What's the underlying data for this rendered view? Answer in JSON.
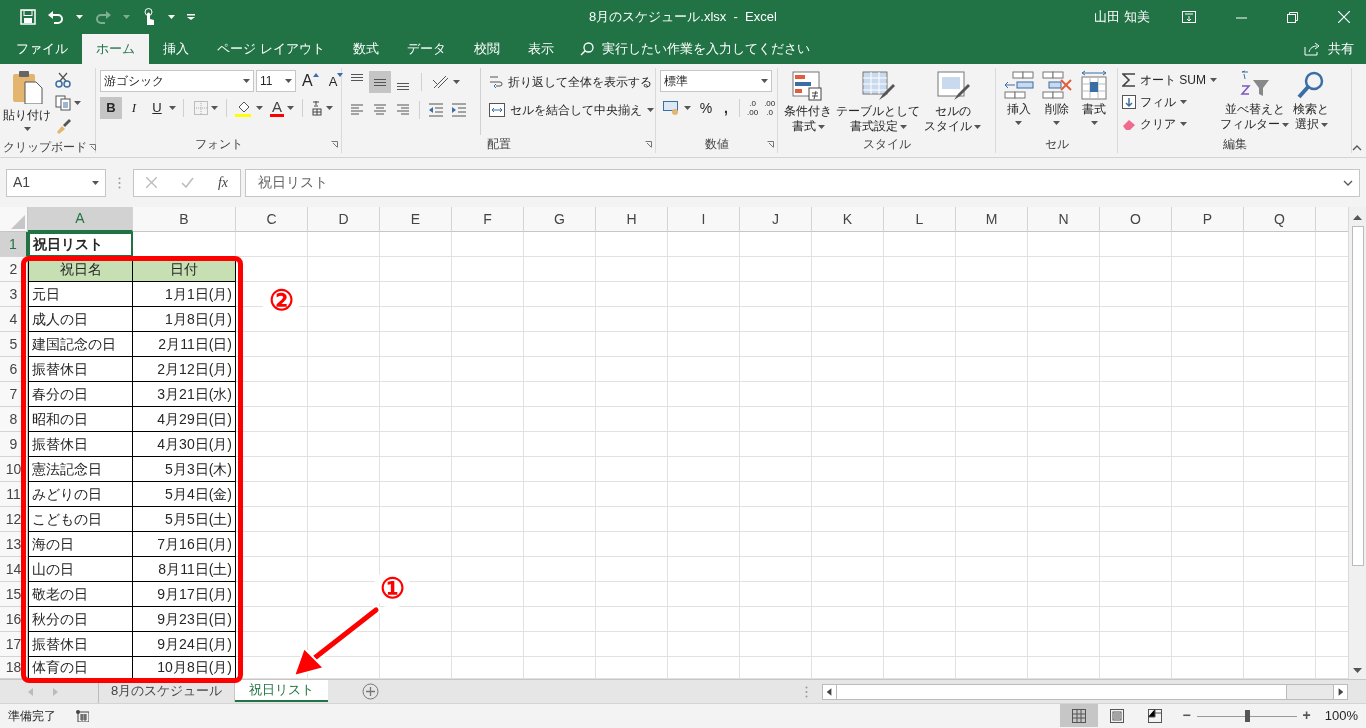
{
  "window": {
    "title": "8月のスケジュール.xlsx  -  Excel",
    "user": "山田 知美"
  },
  "ribbon_tabs": [
    {
      "label": "ファイル",
      "selected": false
    },
    {
      "label": "ホーム",
      "selected": true
    },
    {
      "label": "挿入",
      "selected": false
    },
    {
      "label": "ページ レイアウト",
      "selected": false
    },
    {
      "label": "数式",
      "selected": false
    },
    {
      "label": "データ",
      "selected": false
    },
    {
      "label": "校閲",
      "selected": false
    },
    {
      "label": "表示",
      "selected": false
    }
  ],
  "tell_me": {
    "placeholder": "実行したい作業を入力してください"
  },
  "share": "共有",
  "ribbon": [
    {
      "kind": "clipboard",
      "label": "クリップボード",
      "paste": "貼り付け"
    },
    {
      "kind": "font",
      "label": "フォント",
      "font_name": "游ゴシック",
      "font_size": "11",
      "grow": "A",
      "shrink": "A",
      "styles": [
        {
          "text": "B",
          "on": true
        },
        {
          "text": "I",
          "on": false
        },
        {
          "text": "U",
          "on": false
        }
      ],
      "font_color": "A"
    },
    {
      "kind": "alignment",
      "label": "配置",
      "vertical_align": [
        {
          "selected": false
        },
        {
          "selected": true
        },
        {
          "selected": false
        }
      ],
      "wrap_text": "折り返して全体を表示する",
      "merge_center": "セルを結合して中央揃え"
    },
    {
      "kind": "number",
      "label": "数値",
      "format": "標準",
      "percent": "%",
      "comma": ",",
      "increase_decimal": [
        ".0",
        ".00"
      ],
      "decrease_decimal": [
        ".00",
        ".0"
      ]
    },
    {
      "kind": "styles",
      "label": "スタイル",
      "buttons": [
        [
          "条件付き",
          "書式"
        ],
        [
          "テーブルとして",
          "書式設定"
        ],
        [
          "セルの",
          "スタイル"
        ]
      ]
    },
    {
      "kind": "cells",
      "label": "セル",
      "buttons": [
        "挿入",
        "削除",
        "書式"
      ]
    },
    {
      "kind": "editing",
      "label": "編集",
      "autosum": "オート SUM",
      "fill": "フィル",
      "clear": "クリア",
      "buttons": [
        [
          "並べ替えと",
          "フィルター"
        ],
        [
          "検索と",
          "選択"
        ]
      ]
    }
  ],
  "formula_bar": {
    "name_box": "A1",
    "fx": "fx",
    "value": "祝日リスト"
  },
  "sheet": {
    "columns": [
      {
        "label": "A",
        "selected": true
      },
      {
        "label": "B",
        "selected": false
      },
      {
        "label": "C",
        "selected": false
      },
      {
        "label": "D",
        "selected": false
      },
      {
        "label": "E",
        "selected": false
      },
      {
        "label": "F",
        "selected": false
      },
      {
        "label": "G",
        "selected": false
      },
      {
        "label": "H",
        "selected": false
      },
      {
        "label": "I",
        "selected": false
      },
      {
        "label": "J",
        "selected": false
      },
      {
        "label": "K",
        "selected": false
      },
      {
        "label": "L",
        "selected": false
      },
      {
        "label": "M",
        "selected": false
      },
      {
        "label": "N",
        "selected": false
      },
      {
        "label": "O",
        "selected": false
      },
      {
        "label": "P",
        "selected": false
      },
      {
        "label": "Q",
        "selected": false
      }
    ],
    "rows": [
      {
        "number": "1",
        "selected": true,
        "kind": "title",
        "cells": [
          "祝日リスト"
        ]
      },
      {
        "number": "2",
        "selected": false,
        "kind": "header",
        "cells": [
          "祝日名",
          "日付"
        ]
      },
      {
        "number": "3",
        "selected": false,
        "kind": "data",
        "cells": [
          "元日",
          "1月1日(月)"
        ]
      },
      {
        "number": "4",
        "selected": false,
        "kind": "data",
        "cells": [
          "成人の日",
          "1月8日(月)"
        ]
      },
      {
        "number": "5",
        "selected": false,
        "kind": "data",
        "cells": [
          "建国記念の日",
          "2月11日(日)"
        ]
      },
      {
        "number": "6",
        "selected": false,
        "kind": "data",
        "cells": [
          "振替休日",
          "2月12日(月)"
        ]
      },
      {
        "number": "7",
        "selected": false,
        "kind": "data",
        "cells": [
          "春分の日",
          "3月21日(水)"
        ]
      },
      {
        "number": "8",
        "selected": false,
        "kind": "data",
        "cells": [
          "昭和の日",
          "4月29日(日)"
        ]
      },
      {
        "number": "9",
        "selected": false,
        "kind": "data",
        "cells": [
          "振替休日",
          "4月30日(月)"
        ]
      },
      {
        "number": "10",
        "selected": false,
        "kind": "data",
        "cells": [
          "憲法記念日",
          "5月3日(木)"
        ]
      },
      {
        "number": "11",
        "selected": false,
        "kind": "data",
        "cells": [
          "みどりの日",
          "5月4日(金)"
        ]
      },
      {
        "number": "12",
        "selected": false,
        "kind": "data",
        "cells": [
          "こどもの日",
          "5月5日(土)"
        ]
      },
      {
        "number": "13",
        "selected": false,
        "kind": "data",
        "cells": [
          "海の日",
          "7月16日(月)"
        ]
      },
      {
        "number": "14",
        "selected": false,
        "kind": "data",
        "cells": [
          "山の日",
          "8月11日(土)"
        ]
      },
      {
        "number": "15",
        "selected": false,
        "kind": "data",
        "cells": [
          "敬老の日",
          "9月17日(月)"
        ]
      },
      {
        "number": "16",
        "selected": false,
        "kind": "data",
        "cells": [
          "秋分の日",
          "9月23日(日)"
        ]
      },
      {
        "number": "17",
        "selected": false,
        "kind": "data",
        "cells": [
          "振替休日",
          "9月24日(月)"
        ]
      },
      {
        "number": "18",
        "selected": false,
        "kind": "data",
        "cells": [
          "体育の日",
          "10月8日(月)"
        ]
      }
    ]
  },
  "sheet_tabs": [
    {
      "label": "8月のスケジュール",
      "selected": false
    },
    {
      "label": "祝日リスト",
      "selected": true
    }
  ],
  "status_bar": {
    "text": "準備完了",
    "views": [
      {
        "selected": true
      },
      {
        "selected": false
      },
      {
        "selected": false
      }
    ],
    "zoom_out": "−",
    "zoom_in": "+",
    "zoom": {
      "level": 0.5
    },
    "zoom_text": "100%"
  },
  "annotations": [
    {
      "label": "②"
    },
    {
      "label": "①"
    }
  ]
}
